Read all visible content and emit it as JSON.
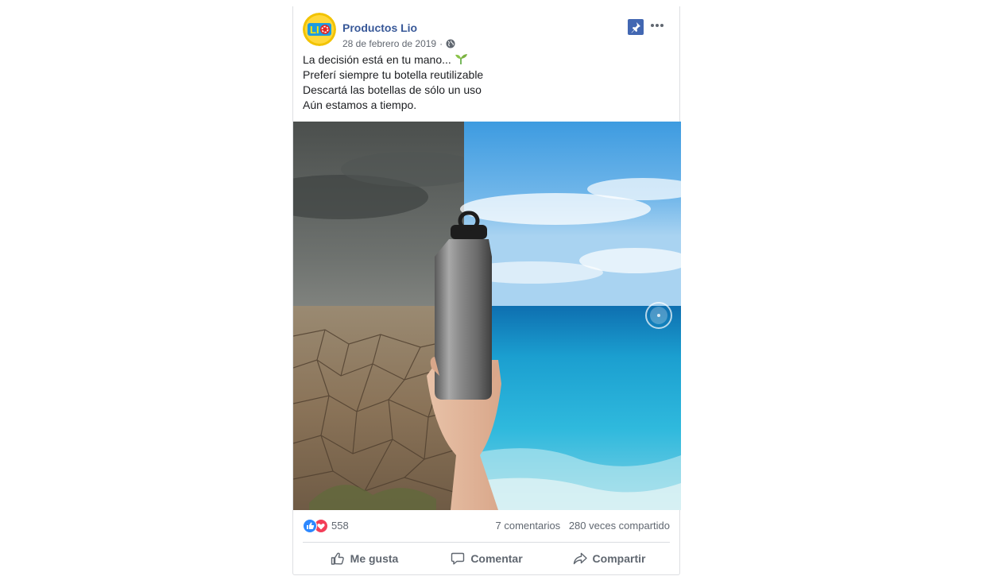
{
  "post": {
    "author": "Productos Lio",
    "date": "28 de febrero de 2019",
    "separator": "·",
    "avatar_text": "LIO",
    "text_lines": [
      "La decisión está en tu mano...",
      "Preferí siempre tu botella reutilizable",
      "Descartá las botellas de sólo un uso",
      "Aún estamos a tiempo."
    ],
    "emoji": "sprout-emoji",
    "image_description_icon": "bottle-photo",
    "reactions": {
      "icons": [
        "like-reaction-icon",
        "love-reaction-icon"
      ],
      "count": "558"
    },
    "comments": "7 comentarios",
    "shares": "280 veces compartido",
    "actions": {
      "like": "Me gusta",
      "comment": "Comentar",
      "share": "Compartir"
    }
  },
  "colors": {
    "author_link": "#385898",
    "pin_badge": "#4267b2",
    "like_blue": "#2d88ff",
    "love_red": "#f33e58",
    "secondary_text": "#606770"
  }
}
